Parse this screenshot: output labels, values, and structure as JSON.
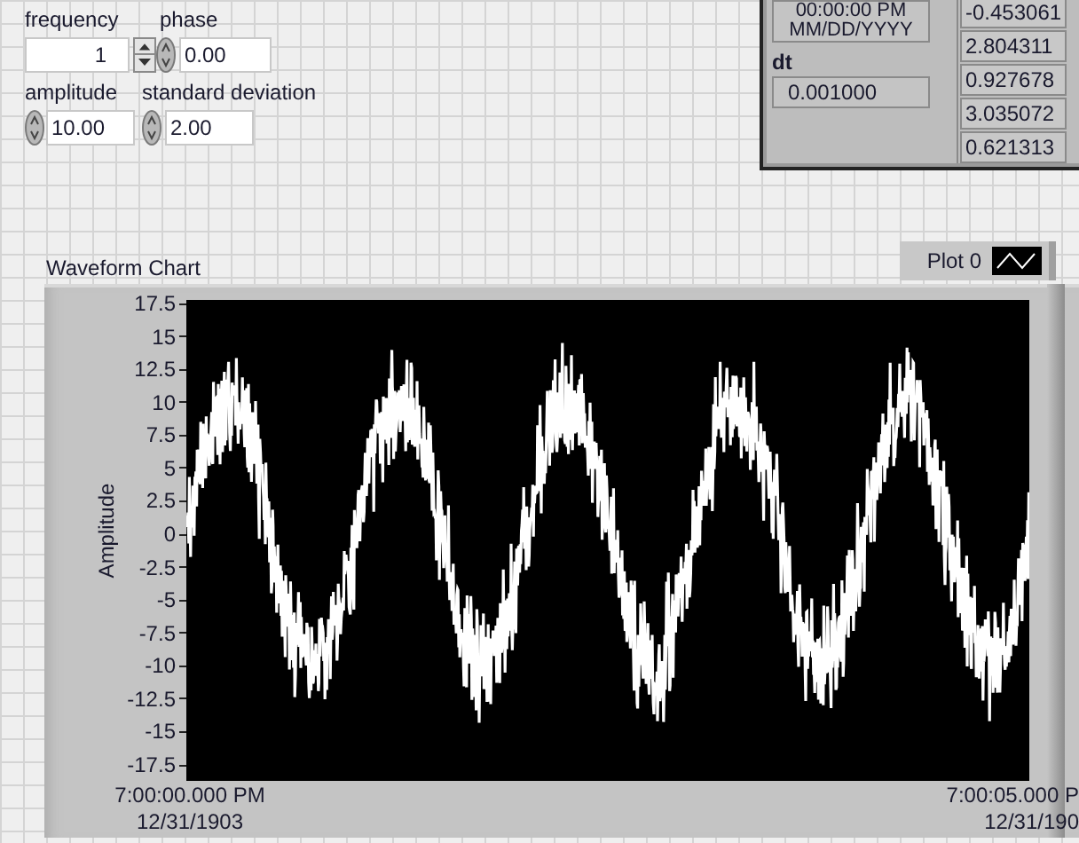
{
  "numeric_controls": [
    {
      "kind": "updown",
      "label": "frequency",
      "value": "1"
    },
    {
      "kind": "knob",
      "label": "phase",
      "value": "0.00"
    },
    {
      "kind": "knob",
      "label": "amplitude",
      "value": "10.00"
    },
    {
      "kind": "knob",
      "label": "standard deviation",
      "value": "2.00"
    }
  ],
  "timestamp": {
    "time": "00:00:00 PM",
    "date": "MM/DD/YYYY"
  },
  "dt": {
    "label": "dt",
    "value": "0.001000"
  },
  "array_values": [
    "-0.453061",
    "2.804311",
    "0.927678",
    "3.035072",
    "0.621313"
  ],
  "chart": {
    "title": "Waveform Chart",
    "legend": {
      "label": "Plot 0"
    },
    "ylabel": "Amplitude",
    "yticks": [
      "17.5",
      "15",
      "12.5",
      "10",
      "7.5",
      "5",
      "2.5",
      "0",
      "-2.5",
      "-5",
      "-7.5",
      "-10",
      "-12.5",
      "-15",
      "-17.5"
    ],
    "xticks": [
      {
        "time": "7:00:00.000 PM",
        "date": "12/31/1903"
      },
      {
        "time": "7:00:05.000 P",
        "date": "12/31/190"
      }
    ]
  }
}
